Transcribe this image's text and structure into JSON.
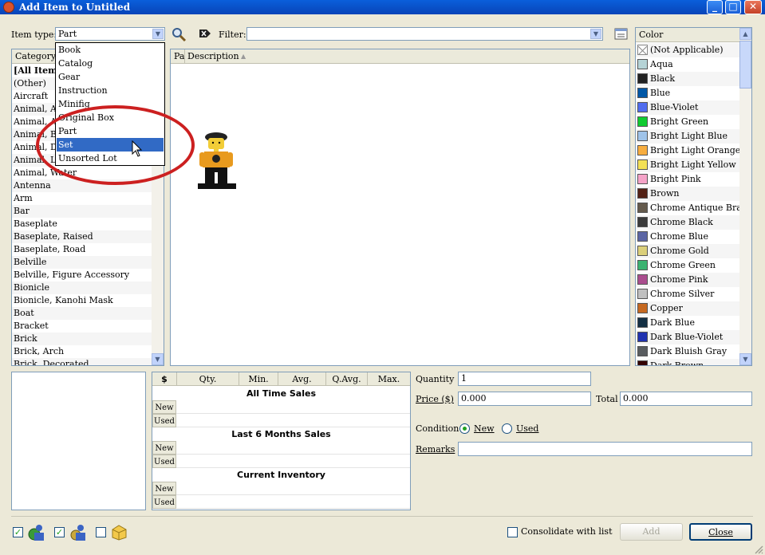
{
  "window": {
    "title": "Add Item to Untitled",
    "controls": [
      "_",
      "□",
      "✕"
    ]
  },
  "toolbar": {
    "item_type_label": "Item type:",
    "item_type_value": "Part",
    "filter_label": "Filter:",
    "filter_value": ""
  },
  "dropdown": {
    "items": [
      "Book",
      "Catalog",
      "Gear",
      "Instruction",
      "Minifig",
      "Original Box",
      "Part",
      "Set",
      "Unsorted Lot"
    ],
    "selected": "Set"
  },
  "category": {
    "header": "Category",
    "items": [
      "[All Items]",
      "(Other)",
      "Aircraft",
      "Animal, Ac",
      "Animal, A",
      "Animal, Bo",
      "Animal, Du",
      "Animal, La",
      "Animal, Water",
      "Antenna",
      "Arm",
      "Bar",
      "Baseplate",
      "Baseplate, Raised",
      "Baseplate, Road",
      "Belville",
      "Belville, Figure Accessory",
      "Bionicle",
      "Bionicle, Kanohi Mask",
      "Boat",
      "Bracket",
      "Brick",
      "Brick, Arch",
      "Brick, Decorated"
    ]
  },
  "items_list": {
    "col_part": "Pa",
    "col_description": "Description",
    "sort_glyph": "▲"
  },
  "color": {
    "header": "Color",
    "items": [
      {
        "name": "(Not Applicable)",
        "hex": "#ffffff"
      },
      {
        "name": "Aqua",
        "hex": "#b5d3d6"
      },
      {
        "name": "Black",
        "hex": "#212121"
      },
      {
        "name": "Blue",
        "hex": "#0057a6"
      },
      {
        "name": "Blue-Violet",
        "hex": "#506cef"
      },
      {
        "name": "Bright Green",
        "hex": "#10cb31"
      },
      {
        "name": "Bright Light Blue",
        "hex": "#9fc3e9"
      },
      {
        "name": "Bright Light Orange",
        "hex": "#f7ad3f"
      },
      {
        "name": "Bright Light Yellow",
        "hex": "#f3e055"
      },
      {
        "name": "Bright Pink",
        "hex": "#f5a3c8"
      },
      {
        "name": "Brown",
        "hex": "#532115"
      },
      {
        "name": "Chrome Antique Brass",
        "hex": "#645a4c"
      },
      {
        "name": "Chrome Black",
        "hex": "#3a3a3a"
      },
      {
        "name": "Chrome Blue",
        "hex": "#5c66a4"
      },
      {
        "name": "Chrome Gold",
        "hex": "#dbcf7a"
      },
      {
        "name": "Chrome Green",
        "hex": "#3cb371"
      },
      {
        "name": "Chrome Pink",
        "hex": "#aa4d8e"
      },
      {
        "name": "Chrome Silver",
        "hex": "#c0c0c0"
      },
      {
        "name": "Copper",
        "hex": "#c66921"
      },
      {
        "name": "Dark Blue",
        "hex": "#143044"
      },
      {
        "name": "Dark Blue-Violet",
        "hex": "#2032b0"
      },
      {
        "name": "Dark Bluish Gray",
        "hex": "#595d60"
      },
      {
        "name": "Dark Brown",
        "hex": "#330000"
      }
    ]
  },
  "price_guide": {
    "headers": [
      "$",
      "Qty.",
      "Min.",
      "Avg.",
      "Q.Avg.",
      "Max."
    ],
    "sections": [
      "All Time Sales",
      "Last 6 Months Sales",
      "Current Inventory"
    ],
    "row_labels": [
      "New",
      "Used"
    ]
  },
  "form": {
    "quantity_label": "Quantity",
    "quantity_value": "1",
    "price_label": "Price ($)",
    "price_value": "0.000",
    "total_label": "Total",
    "total_value": "0.000",
    "condition_label": "Condition",
    "condition_new": "New",
    "condition_used": "Used",
    "condition_selected": "New",
    "remarks_label": "Remarks",
    "remarks_value": ""
  },
  "bottom": {
    "consolidate_label": "Consolidate with list",
    "add_label": "Add",
    "close_label": "Close"
  }
}
